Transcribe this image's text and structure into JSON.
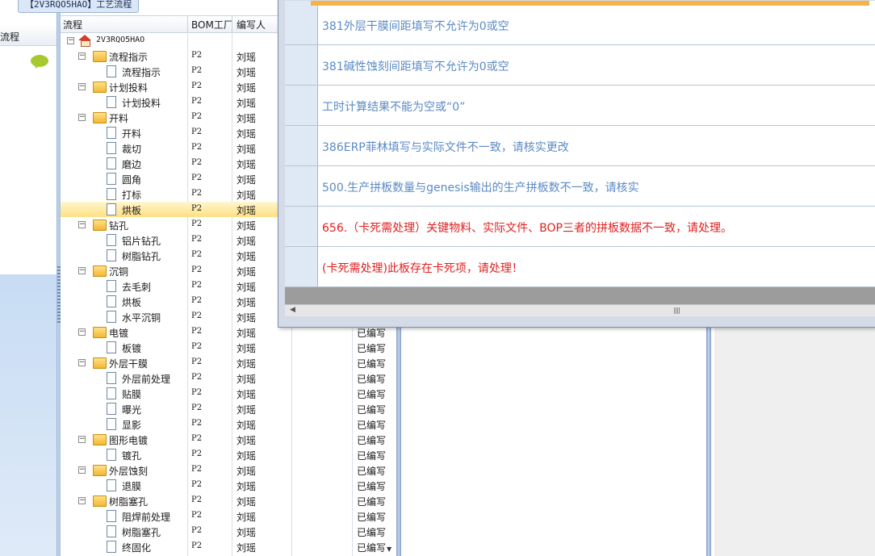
{
  "left_panel": {
    "label": "流程",
    "chat_icon": "speech-bubble-icon"
  },
  "process": {
    "title": "【2V3RQO5HAO】工艺流程",
    "columns": {
      "flow": "流程",
      "bom": "BOM工厂",
      "writer": "编写人"
    },
    "root": {
      "name": "2V3RQO5HAO",
      "icon": "home-icon"
    },
    "rows": [
      {
        "name": "流程指示",
        "level": 1,
        "type": "folder",
        "factory": "P2",
        "writer": "刘瑶"
      },
      {
        "name": "流程指示",
        "level": 2,
        "type": "doc",
        "factory": "P2",
        "writer": "刘瑶"
      },
      {
        "name": "计划投料",
        "level": 1,
        "type": "folder",
        "factory": "P2",
        "writer": "刘瑶"
      },
      {
        "name": "计划投料",
        "level": 2,
        "type": "doc",
        "factory": "P2",
        "writer": "刘瑶"
      },
      {
        "name": "开料",
        "level": 1,
        "type": "folder",
        "factory": "P2",
        "writer": "刘瑶"
      },
      {
        "name": "开料",
        "level": 2,
        "type": "doc",
        "factory": "P2",
        "writer": "刘瑶"
      },
      {
        "name": "裁切",
        "level": 2,
        "type": "doc",
        "factory": "P2",
        "writer": "刘瑶"
      },
      {
        "name": "磨边",
        "level": 2,
        "type": "doc",
        "factory": "P2",
        "writer": "刘瑶"
      },
      {
        "name": "圆角",
        "level": 2,
        "type": "doc",
        "factory": "P2",
        "writer": "刘瑶"
      },
      {
        "name": "打标",
        "level": 2,
        "type": "doc",
        "factory": "P2",
        "writer": "刘瑶"
      },
      {
        "name": "烘板",
        "level": 2,
        "type": "doc",
        "factory": "P2",
        "writer": "刘瑶",
        "selected": true
      },
      {
        "name": "钻孔",
        "level": 1,
        "type": "folder",
        "factory": "P2",
        "writer": "刘瑶"
      },
      {
        "name": "铝片钻孔",
        "level": 2,
        "type": "doc",
        "factory": "P2",
        "writer": "刘瑶"
      },
      {
        "name": "树脂钻孔",
        "level": 2,
        "type": "doc",
        "factory": "P2",
        "writer": "刘瑶"
      },
      {
        "name": "沉铜",
        "level": 1,
        "type": "folder",
        "factory": "P2",
        "writer": "刘瑶"
      },
      {
        "name": "去毛刺",
        "level": 2,
        "type": "doc",
        "factory": "P2",
        "writer": "刘瑶"
      },
      {
        "name": "烘板",
        "level": 2,
        "type": "doc",
        "factory": "P2",
        "writer": "刘瑶"
      },
      {
        "name": "水平沉铜",
        "level": 2,
        "type": "doc",
        "factory": "P2",
        "writer": "刘瑶"
      },
      {
        "name": "电镀",
        "level": 1,
        "type": "folder",
        "factory": "P2",
        "writer": "刘瑶",
        "status": "已编写"
      },
      {
        "name": "板镀",
        "level": 2,
        "type": "doc",
        "factory": "P2",
        "writer": "刘瑶",
        "status": "已编写"
      },
      {
        "name": "外层干膜",
        "level": 1,
        "type": "folder",
        "factory": "P2",
        "writer": "刘瑶",
        "status": "已编写"
      },
      {
        "name": "外层前处理",
        "level": 2,
        "type": "doc",
        "factory": "P2",
        "writer": "刘瑶",
        "status": "已编写"
      },
      {
        "name": "贴膜",
        "level": 2,
        "type": "doc",
        "factory": "P2",
        "writer": "刘瑶",
        "status": "已编写"
      },
      {
        "name": "曝光",
        "level": 2,
        "type": "doc",
        "factory": "P2",
        "writer": "刘瑶",
        "status": "已编写"
      },
      {
        "name": "显影",
        "level": 2,
        "type": "doc",
        "factory": "P2",
        "writer": "刘瑶",
        "status": "已编写"
      },
      {
        "name": "图形电镀",
        "level": 1,
        "type": "folder",
        "factory": "P2",
        "writer": "刘瑶",
        "status": "已编写"
      },
      {
        "name": "镀孔",
        "level": 2,
        "type": "doc",
        "factory": "P2",
        "writer": "刘瑶",
        "status": "已编写"
      },
      {
        "name": "外层蚀刻",
        "level": 1,
        "type": "folder",
        "factory": "P2",
        "writer": "刘瑶",
        "status": "已编写"
      },
      {
        "name": "退膜",
        "level": 2,
        "type": "doc",
        "factory": "P2",
        "writer": "刘瑶",
        "status": "已编写"
      },
      {
        "name": "树脂塞孔",
        "level": 1,
        "type": "folder",
        "factory": "P2",
        "writer": "刘瑶",
        "status": "已编写"
      },
      {
        "name": "阻焊前处理",
        "level": 2,
        "type": "doc",
        "factory": "P2",
        "writer": "刘瑶",
        "status": "已编写"
      },
      {
        "name": "树脂塞孔",
        "level": 2,
        "type": "doc",
        "factory": "P2",
        "writer": "刘瑶",
        "status": "已编写"
      },
      {
        "name": "终固化",
        "level": 2,
        "type": "doc",
        "factory": "P2",
        "writer": "刘瑶",
        "status": "已编写"
      }
    ]
  },
  "errors": {
    "colors": {
      "info": "#5b8ac4",
      "critical": "#e02020"
    },
    "messages": [
      {
        "text": "381外层干膜间距填写不允许为0或空",
        "severity": "info"
      },
      {
        "text": "381碱性蚀刻间距填写不允许为0或空",
        "severity": "info"
      },
      {
        "text": "工时计算结果不能为空或“0”",
        "severity": "info"
      },
      {
        "text": "386ERP菲林填写与实际文件不一致，请核实更改",
        "severity": "info"
      },
      {
        "text": "500.生产拼板数量与genesis输出的生产拼板数不一致，请核实",
        "severity": "info"
      },
      {
        "text": "656.（卡死需处理）关键物料、实际文件、BOP三者的拼板数据不一致，请处理。",
        "severity": "critical"
      },
      {
        "text": "(卡死需处理)此板存在卡死项，请处理！",
        "severity": "critical"
      }
    ]
  }
}
